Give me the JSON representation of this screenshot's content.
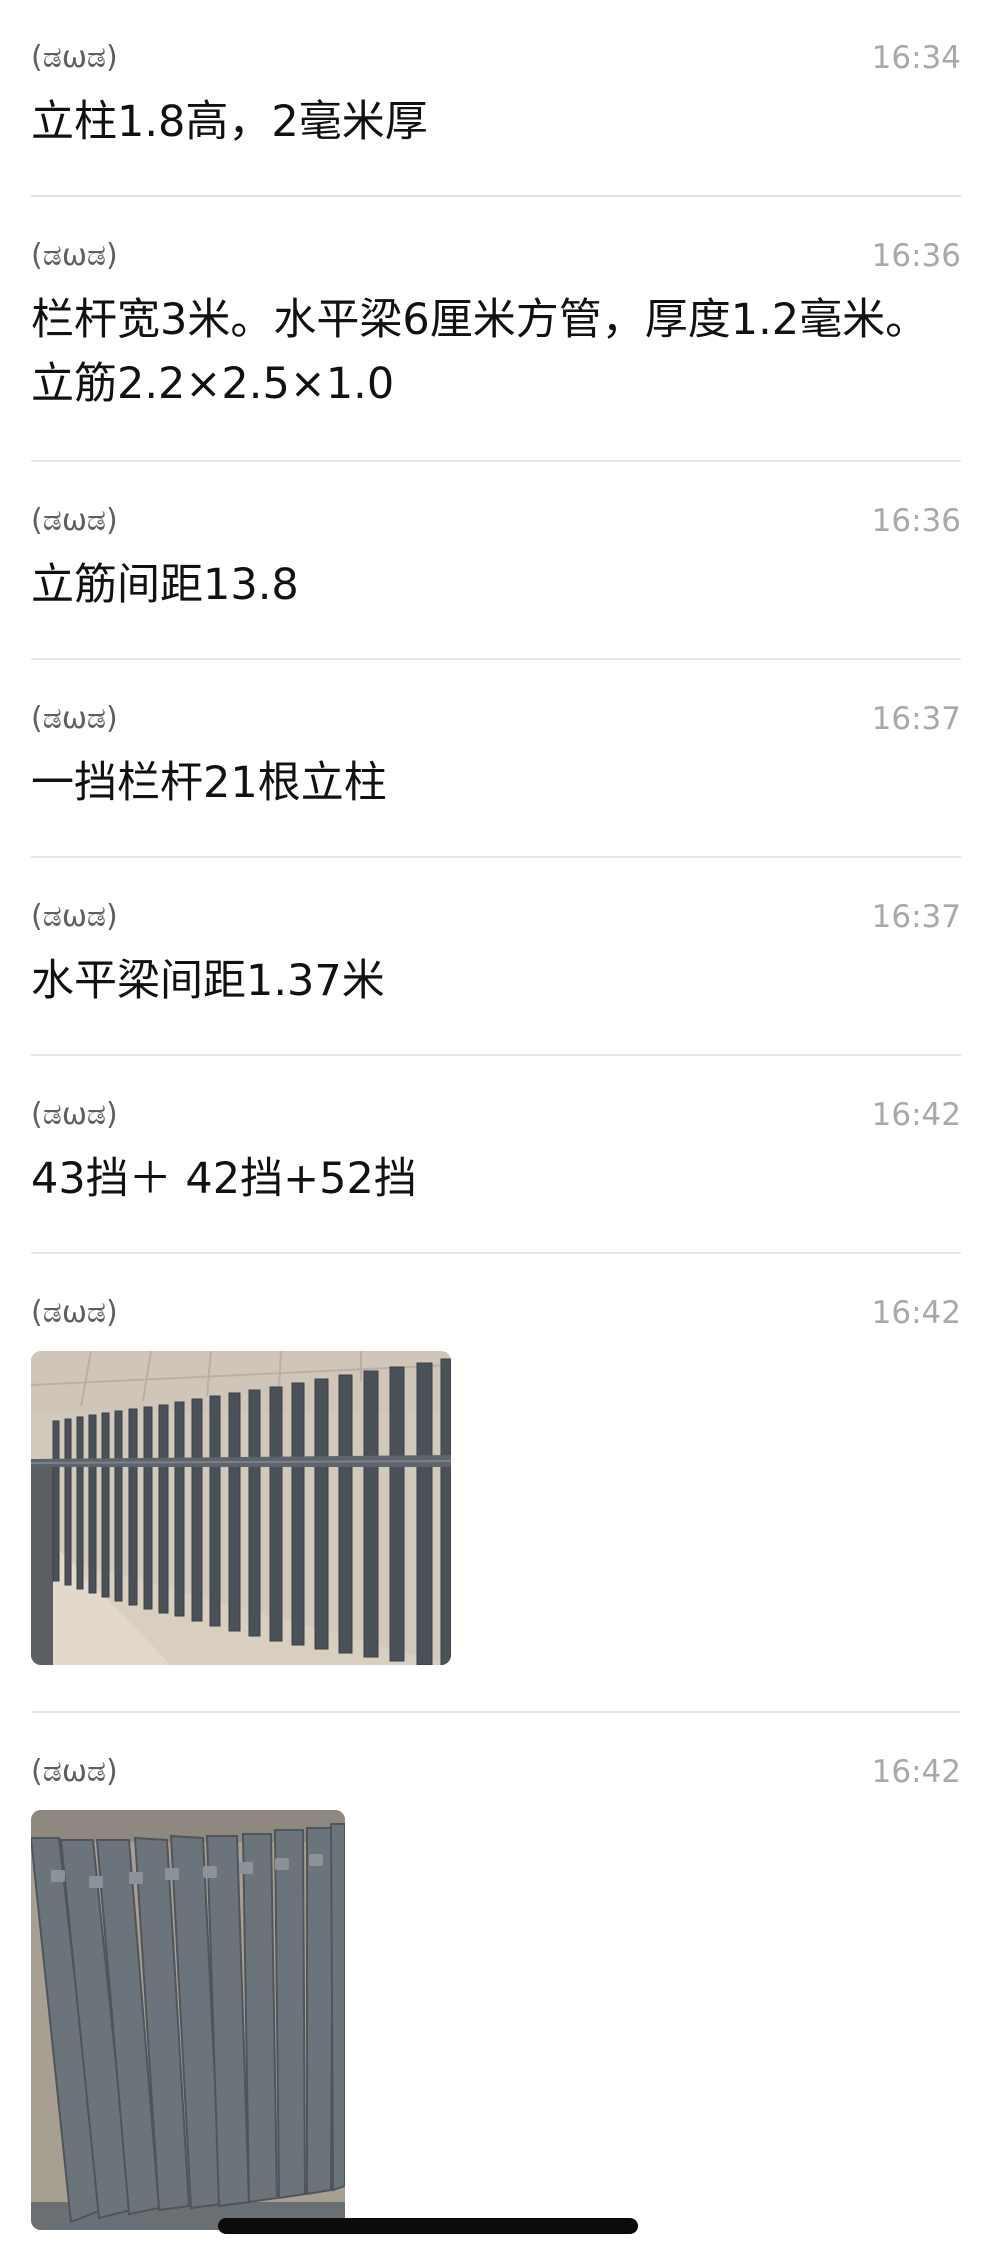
{
  "messages": [
    {
      "sender": "(ಡωಡ)",
      "time": "16:34",
      "text": "立柱1.8高，2毫米厚"
    },
    {
      "sender": "(ಡωಡ)",
      "time": "16:36",
      "text": "栏杆宽3米。水平梁6厘米方管，厚度1.2毫米。立筋2.2×2.5×1.0"
    },
    {
      "sender": "(ಡωಡ)",
      "time": "16:36",
      "text": "立筋间距13.8"
    },
    {
      "sender": "(ಡωಡ)",
      "time": "16:37",
      "text": "一挡栏杆21根立柱"
    },
    {
      "sender": "(ಡωಡ)",
      "time": "16:37",
      "text": "水平梁间距1.37米"
    },
    {
      "sender": "(ಡωಡ)",
      "time": "16:42",
      "text": "43挡＋ 42挡+52挡"
    },
    {
      "sender": "(ಡωಡ)",
      "time": "16:42",
      "image": "photo-fence-installed"
    },
    {
      "sender": "(ಡωಡ)",
      "time": "16:42",
      "image": "photo-fence-posts-stacked"
    }
  ],
  "colors": {
    "sender": "#5f5f5f",
    "time": "#a9a9a9",
    "text": "#111111",
    "separator": "#e4e4e4",
    "fence_metal": "#4a5158",
    "wall_tile": "#c9c0b4",
    "floor": "#d8cfc2"
  }
}
